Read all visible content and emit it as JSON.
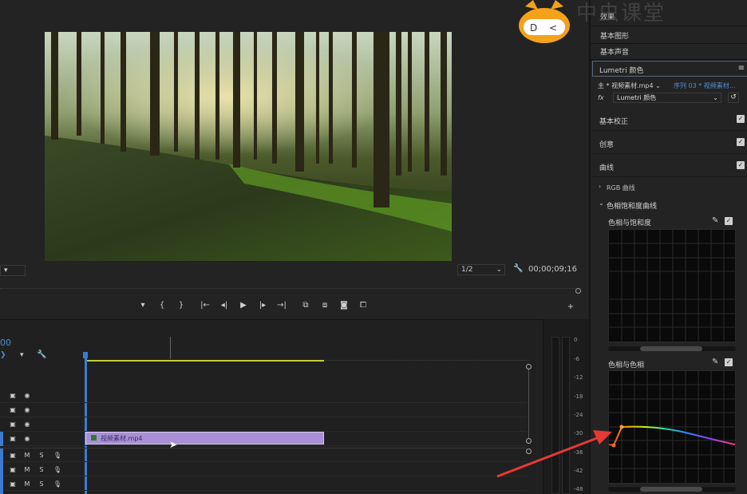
{
  "panel": {
    "tabs": [
      "效果",
      "基本图形",
      "基本声音"
    ],
    "lumetri_title": "Lumetri 颜色",
    "source_label": "主 * 视频素材.mp4",
    "sequence_label": "序列 03 * 视频素材...",
    "fx_label": "fx",
    "fx_value": "Lumetri 颜色",
    "sections": [
      {
        "label": "基本校正",
        "checked": true
      },
      {
        "label": "创意",
        "checked": true
      },
      {
        "label": "曲线",
        "checked": true
      }
    ],
    "rgb_curve": "RGB 曲线",
    "hue_sat_curve": "色相饱和度曲线",
    "hue_vs_sat": "色相与饱和度",
    "hue_vs_hue": "色相与色相"
  },
  "monitor": {
    "fit_select": "1/2",
    "timecode": "00;00;09;16",
    "transport_icons": [
      "marker-icon",
      "in-point-icon",
      "out-point-icon",
      "go-to-in-icon",
      "step-back-icon",
      "play-icon",
      "step-forward-icon",
      "go-to-out-icon",
      "lift-icon",
      "extract-icon",
      "export-frame-icon",
      "compare-icon"
    ]
  },
  "timeline": {
    "partial_timecode": "00",
    "clip_label": "视频素材.mp4",
    "track_labels": [
      "M",
      "S"
    ]
  },
  "meter": {
    "ticks": [
      "0",
      "-6",
      "-12",
      "-18",
      "-24",
      "-30",
      "-36",
      "-42",
      "-48"
    ]
  },
  "watermark": "中虫课堂",
  "colors": {
    "clip": "#a990d6",
    "accent": "#4f8fd9",
    "annotation_arrow": "#e53935",
    "logo": "#f4a21b"
  }
}
